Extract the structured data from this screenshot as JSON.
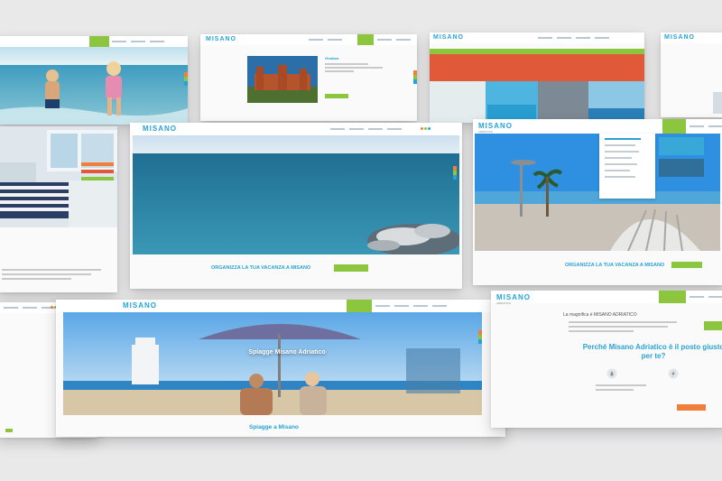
{
  "brand": {
    "logo": "MISANO",
    "tagline": "ADRIATICO"
  },
  "colors": {
    "accent": "#27a3d6",
    "green": "#8cc63f",
    "orange": "#f07f3c",
    "red": "#e05a3a",
    "bg": "#e9e9ea"
  },
  "cards": {
    "beach_hero": {
      "banner": "Spiagge Misano Adriatico",
      "footer_title": "Spiagge a Misano"
    },
    "sea_view": {
      "cta": "ORGANIZZA LA TUA VACANZA A MISANO"
    },
    "square_view": {
      "cta": "ORGANIZZA LA TUA VACANZA A MISANO"
    },
    "why_misano": {
      "intro": "La magnifica è MISANO ADRIATICO",
      "headline": "Perché Misano Adriatico è il posto giusto per te?"
    },
    "castle_listing": {
      "title": "Gradara"
    }
  }
}
